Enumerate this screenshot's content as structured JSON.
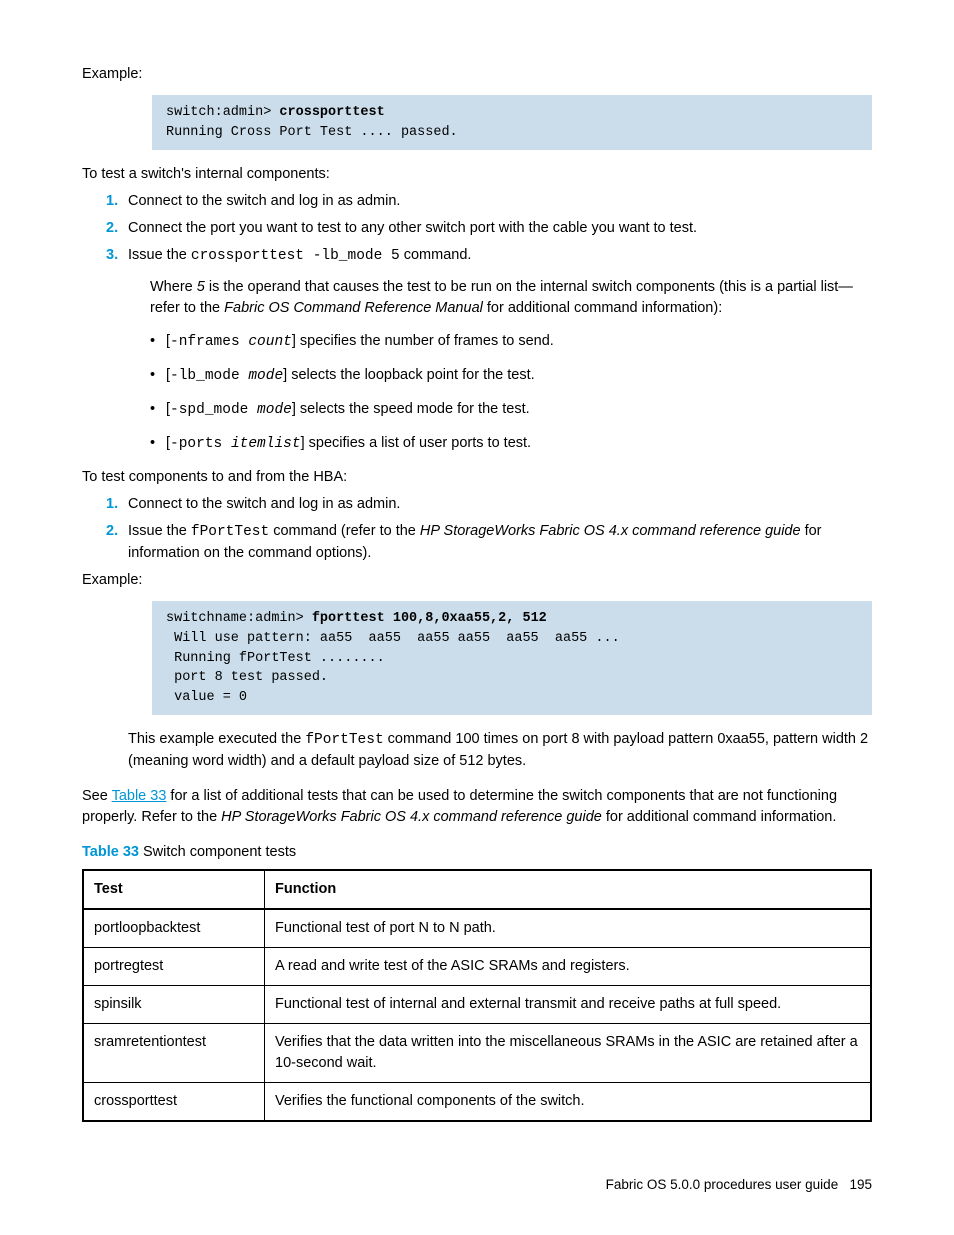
{
  "p_example1": "Example:",
  "code1_prompt": "switch:admin> ",
  "code1_cmd": "crossporttest",
  "code1_out": "Running Cross Port Test .... passed.",
  "p_intro1": "To test a switch's internal components:",
  "steps1": {
    "s1": "Connect to the switch and log in as admin.",
    "s2": "Connect the port you want to test to any other switch port with the cable you want to test.",
    "s3_a": "Issue the ",
    "s3_cmd": "crossporttest -lb_mode 5",
    "s3_b": " command.",
    "s3_sub_a": "Where ",
    "s3_sub_5": "5",
    "s3_sub_b": " is the operand that causes the test to be run on the internal switch components (this is a partial list—refer to the ",
    "s3_sub_ref": "Fabric OS Command Reference Manual",
    "s3_sub_c": " for additional command information):",
    "opts": {
      "o1_a": "[",
      "o1_cmd": "-nframes ",
      "o1_arg": "count",
      "o1_b": "] specifies the number of frames to send.",
      "o2_a": "[",
      "o2_cmd": "-lb_mode ",
      "o2_arg": "mode",
      "o2_b": "] selects the loopback point for the test.",
      "o3_a": "[",
      "o3_cmd": "-spd_mode ",
      "o3_arg": "mode",
      "o3_b": "] selects the speed mode for the test.",
      "o4_a": "[",
      "o4_cmd": "-ports ",
      "o4_arg": "itemlist",
      "o4_b": "] specifies a list of user ports to test."
    }
  },
  "p_intro2": "To test components to and from the HBA:",
  "steps2": {
    "s1": "Connect to the switch and log in as admin.",
    "s2_a": "Issue the ",
    "s2_cmd": "fPortTest",
    "s2_b": " command (refer to the ",
    "s2_ref": "HP StorageWorks Fabric OS 4.x command reference guide",
    "s2_c": " for information on the command options)."
  },
  "p_example2": "Example:",
  "code2_prompt": "switchname:admin> ",
  "code2_cmd": "fporttest 100,8,0xaa55,2, 512",
  "code2_out": " Will use pattern: aa55  aa55  aa55 aa55  aa55  aa55 ...\n Running fPortTest ........\n port 8 test passed.\n value = 0",
  "p_after_code2_a": "This example executed the ",
  "p_after_code2_cmd": "fPortTest",
  "p_after_code2_b": " command 100 times on port 8 with payload pattern 0xaa55, pattern width 2 (meaning word width) and a default payload size of 512 bytes.",
  "p_see_a": "See ",
  "p_see_link": "Table 33",
  "p_see_b": " for a list of additional tests that can be used to determine the switch components that are not functioning properly. Refer to the ",
  "p_see_ref": "HP StorageWorks Fabric OS 4.x command reference guide",
  "p_see_c": " for additional command information.",
  "table": {
    "caption_label": "Table 33",
    "caption_text": "   Switch component tests",
    "h1": "Test",
    "h2": "Function",
    "rows": [
      {
        "test": "portloopbacktest",
        "func": "Functional test of port N to N path."
      },
      {
        "test": "portregtest",
        "func": "A read and write test of the ASIC SRAMs and registers."
      },
      {
        "test": "spinsilk",
        "func": "Functional test of internal and external transmit and receive paths at full speed."
      },
      {
        "test": "sramretentiontest",
        "func": "Verifies that the data written into the miscellaneous SRAMs in the ASIC are retained after a 10-second wait."
      },
      {
        "test": "crossporttest",
        "func": "Verifies the functional components of the switch."
      }
    ]
  },
  "footer_text": "Fabric OS 5.0.0 procedures user guide",
  "footer_page": "195"
}
